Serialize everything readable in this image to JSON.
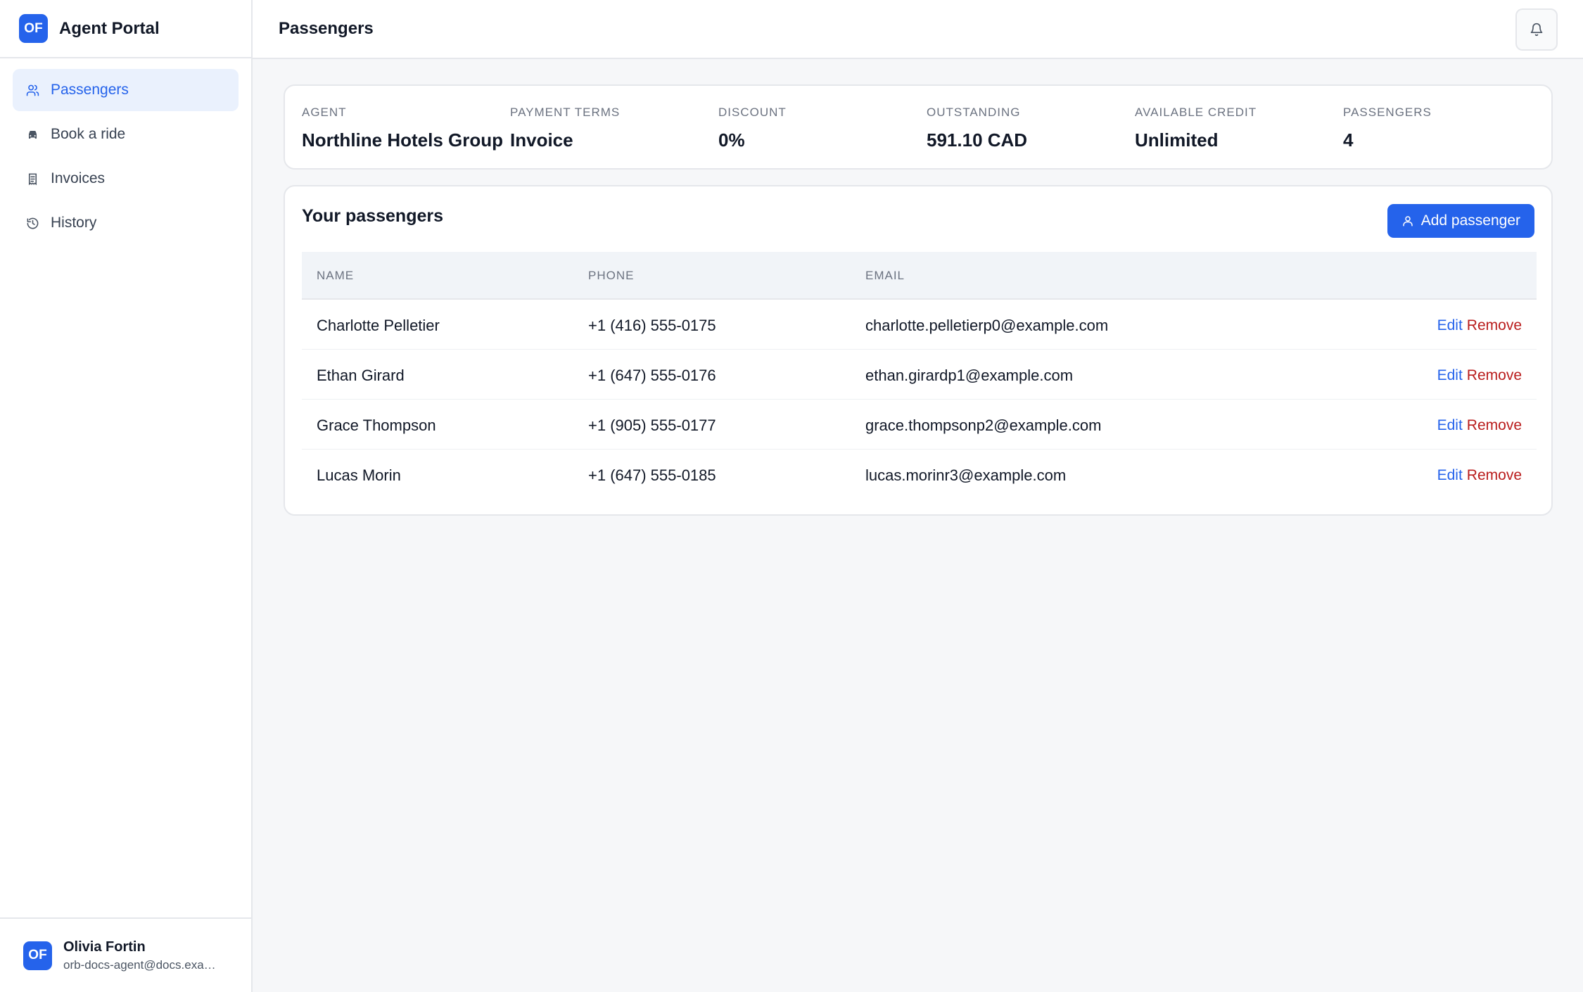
{
  "app": {
    "initials": "OF",
    "title": "Agent Portal"
  },
  "sidebar": {
    "items": [
      {
        "label": "Passengers",
        "icon": "users-icon",
        "active": true
      },
      {
        "label": "Book a ride",
        "icon": "car-icon",
        "active": false
      },
      {
        "label": "Invoices",
        "icon": "receipt-icon",
        "active": false
      },
      {
        "label": "History",
        "icon": "history-icon",
        "active": false
      }
    ]
  },
  "user": {
    "initials": "OF",
    "name": "Olivia Fortin",
    "email": "orb-docs-agent@docs.example.com"
  },
  "header": {
    "title": "Passengers",
    "bell_icon": "bell-icon"
  },
  "summary": {
    "agent_label": "Agent",
    "agent_value": "Northline Hotels Group",
    "terms_label": "Payment terms",
    "terms_value": "Invoice",
    "discount_label": "Discount",
    "discount_value": "0%",
    "outstanding_label": "Outstanding",
    "outstanding_value": "591.10 CAD",
    "credit_label": "Available credit",
    "credit_value": "Unlimited",
    "passengers_label": "Passengers",
    "passengers_value": "4"
  },
  "passengers": {
    "title": "Your passengers",
    "add_label": "Add passenger",
    "columns": {
      "name": "Name",
      "phone": "Phone",
      "email": "Email"
    },
    "edit_label": "Edit",
    "remove_label": "Remove",
    "rows": [
      {
        "name": "Charlotte Pelletier",
        "phone": "+1 (416) 555-0175",
        "email": "charlotte.pelletierp0@example.com"
      },
      {
        "name": "Ethan Girard",
        "phone": "+1 (647) 555-0176",
        "email": "ethan.girardp1@example.com"
      },
      {
        "name": "Grace Thompson",
        "phone": "+1 (905) 555-0177",
        "email": "grace.thompsonp2@example.com"
      },
      {
        "name": "Lucas Morin",
        "phone": "+1 (647) 555-0185",
        "email": "lucas.morinr3@example.com"
      }
    ]
  },
  "colors": {
    "accent": "#2563eb",
    "danger": "#b91c1c",
    "background": "#f6f7f9"
  }
}
